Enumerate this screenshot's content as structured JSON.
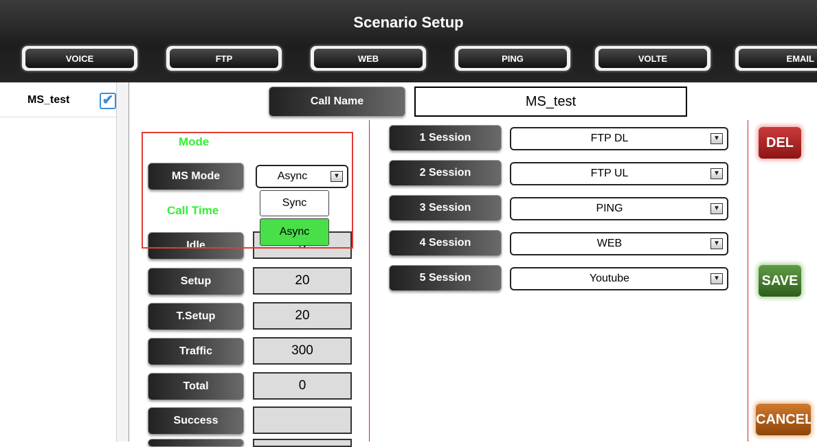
{
  "header": {
    "title": "Scenario Setup"
  },
  "tabs": [
    "VOICE",
    "FTP",
    "WEB",
    "PING",
    "VOLTE",
    "EMAIL"
  ],
  "sidebar": {
    "items": [
      {
        "label": "MS_test",
        "checked": true
      }
    ]
  },
  "call_name": {
    "label": "Call Name",
    "value": "MS_test"
  },
  "mode": {
    "heading": "Mode",
    "ms_mode_label": "MS Mode",
    "ms_mode_value": "Async",
    "options": [
      "Sync",
      "Async"
    ],
    "selected_option": "Async"
  },
  "call_time": {
    "heading": "Call Time",
    "rows": [
      {
        "label": "Idle",
        "value": "5"
      },
      {
        "label": "Setup",
        "value": "20"
      },
      {
        "label": "T.Setup",
        "value": "20"
      },
      {
        "label": "Traffic",
        "value": "300"
      },
      {
        "label": "Total",
        "value": "0"
      },
      {
        "label": "Success",
        "value": ""
      }
    ]
  },
  "sessions": [
    {
      "label": "1 Session",
      "value": "FTP DL"
    },
    {
      "label": "2 Session",
      "value": "FTP UL"
    },
    {
      "label": "3 Session",
      "value": "PING"
    },
    {
      "label": "4 Session",
      "value": "WEB"
    },
    {
      "label": "5 Session",
      "value": "Youtube"
    }
  ],
  "actions": {
    "del": "DEL",
    "save": "SAVE",
    "cancel": "CANCEL"
  },
  "colors": {
    "accent_green": "#33ee33",
    "highlight_red": "#e53935",
    "del": "#c62828",
    "save": "#3f7d2a",
    "cancel": "#b35a12"
  }
}
